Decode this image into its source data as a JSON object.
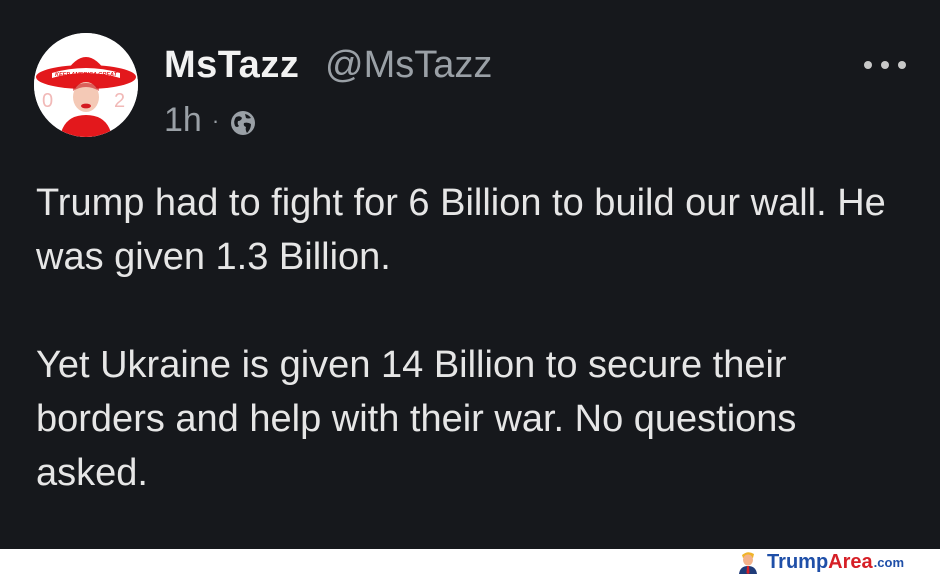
{
  "post": {
    "author_name": "MsTazz",
    "author_handle": "@MsTazz",
    "time": "1h",
    "separator": "·",
    "avatar_text": "KEEP AMERICA GREAT",
    "paragraphs": [
      "Trump had to fight for 6 Billion to build our wall. He was given 1.3 Billion.",
      "Yet Ukraine is given 14 Billion to secure their borders and help with their war. No questions asked."
    ],
    "icons": {
      "visibility": "globe-icon",
      "more": "more-options-icon"
    }
  },
  "watermark": {
    "brand_first": "Trump",
    "brand_second": "Area",
    "brand_tld": ".com"
  },
  "colors": {
    "background": "#16181c",
    "text": "#e7e9ea",
    "secondary": "#9aa0a6",
    "hat_red": "#e3181c",
    "brand_blue": "#1f4fa8",
    "brand_red": "#d61f26"
  }
}
